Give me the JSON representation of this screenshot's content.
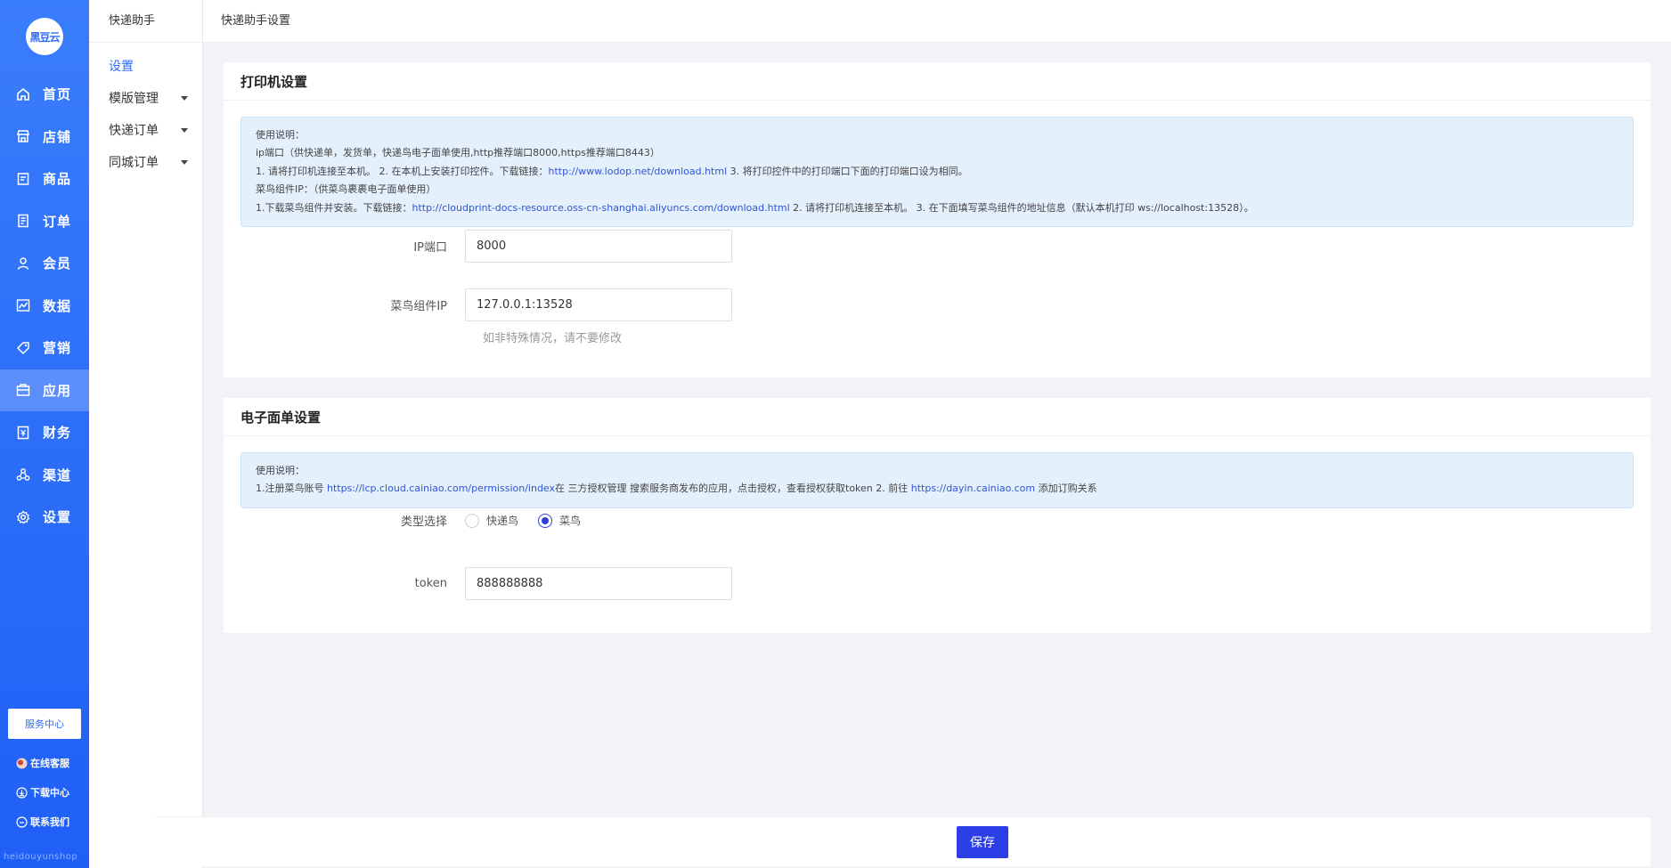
{
  "brand": {
    "logo_text": "黑豆云",
    "watermark": "heidouyunshop"
  },
  "nav": [
    {
      "label": "首页",
      "icon": "home-icon"
    },
    {
      "label": "店铺",
      "icon": "store-icon"
    },
    {
      "label": "商品",
      "icon": "goods-icon"
    },
    {
      "label": "订单",
      "icon": "order-icon"
    },
    {
      "label": "会员",
      "icon": "member-icon"
    },
    {
      "label": "数据",
      "icon": "chart-icon"
    },
    {
      "label": "营销",
      "icon": "tag-icon"
    },
    {
      "label": "应用",
      "icon": "app-icon",
      "active": true
    },
    {
      "label": "财务",
      "icon": "finance-icon"
    },
    {
      "label": "渠道",
      "icon": "channel-icon"
    },
    {
      "label": "设置",
      "icon": "gear-icon"
    }
  ],
  "side_bottom": {
    "service_center": "服务中心",
    "online_service": "在线客服",
    "download_center": "下载中心",
    "contact_us": "联系我们"
  },
  "subside": {
    "title": "快递助手",
    "items": [
      {
        "label": "设置",
        "active": true
      },
      {
        "label": "模版管理",
        "expandable": true
      },
      {
        "label": "快递订单",
        "expandable": true
      },
      {
        "label": "同城订单",
        "expandable": true
      }
    ]
  },
  "header": {
    "breadcrumb": "快递助手设置"
  },
  "printer": {
    "title": "打印机设置",
    "notice": {
      "line1": "使用说明：",
      "line2": "ip端口（供快递单，发货单，快递鸟电子面单使用,http推荐端口8000,https推荐端口8443）",
      "line3_a": "1. 请将打印机连接至本机。 2. 在本机上安装打印控件。下载链接：",
      "line3_link": "http://www.lodop.net/download.html",
      "line3_b": " 3. 将打印控件中的打印端口下面的打印端口设为相同。",
      "line4": "菜鸟组件IP：（供菜鸟裹裹电子面单使用）",
      "line5_a": "1.下载菜鸟组件并安装。下载链接：",
      "line5_link": "http://cloudprint-docs-resource.oss-cn-shanghai.aliyuncs.com/download.html",
      "line5_b": " 2. 请将打印机连接至本机。 3. 在下面填写菜鸟组件的地址信息（默认本机打印 ws://localhost:13528）。"
    },
    "ip_port_label": "IP端口",
    "ip_port_value": "8000",
    "cainiao_ip_label": "菜鸟组件IP",
    "cainiao_ip_value": "127.0.0.1:13528",
    "cainiao_hint": "如非特殊情况，请不要修改"
  },
  "waybill": {
    "title": "电子面单设置",
    "notice": {
      "line1": "使用说明：",
      "line2_a": "1.注册菜鸟账号 ",
      "line2_link1": "https://lcp.cloud.cainiao.com/permission/index",
      "line2_b": "在 三方授权管理 搜索服务商发布的应用，点击授权，查看授权获取token 2. 前往 ",
      "line2_link2": "https://dayin.cainiao.com",
      "line2_c": " 添加订购关系"
    },
    "type_label": "类型选择",
    "options": [
      {
        "label": "快递鸟",
        "checked": false
      },
      {
        "label": "菜鸟",
        "checked": true
      }
    ],
    "token_label": "token",
    "token_value": "888888888"
  },
  "footer": {
    "save_label": "保存"
  },
  "colors": {
    "primary": "#2f6cf8",
    "button": "#2b3ee6",
    "notice_bg": "#e5f0fd",
    "link": "#2f55d4"
  }
}
